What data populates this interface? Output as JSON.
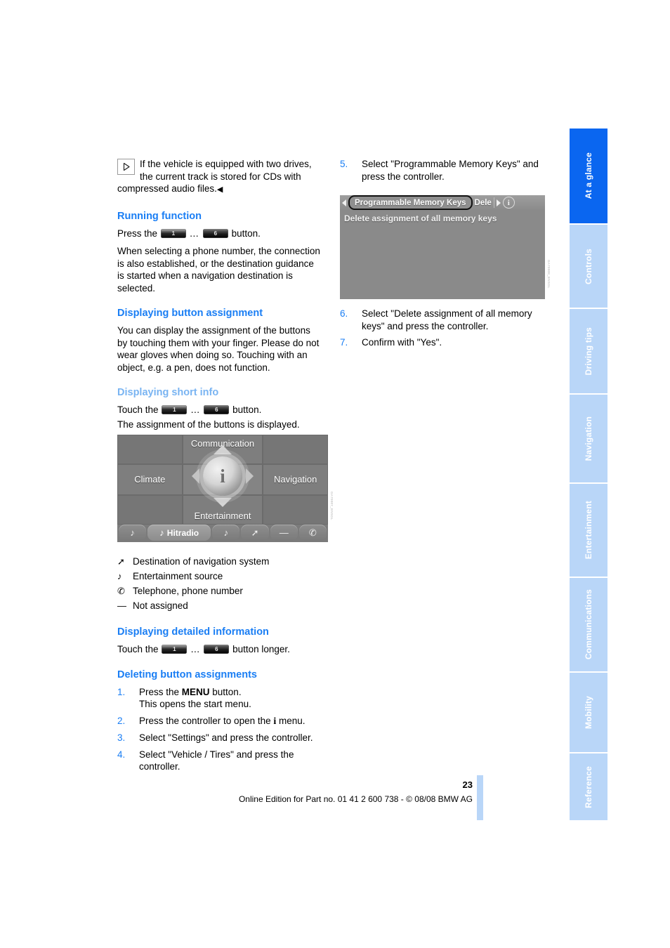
{
  "document": {
    "page_number": "23",
    "footer_line": "Online Edition for Part no. 01 41 2 600 738 - © 08/08 BMW AG"
  },
  "sidebar": {
    "tabs": [
      {
        "label": "At a glance",
        "active": true
      },
      {
        "label": "Controls",
        "active": false
      },
      {
        "label": "Driving tips",
        "active": false
      },
      {
        "label": "Navigation",
        "active": false
      },
      {
        "label": "Entertainment",
        "active": false
      },
      {
        "label": "Communications",
        "active": false
      },
      {
        "label": "Mobility",
        "active": false
      },
      {
        "label": "Reference",
        "active": false
      }
    ],
    "active_color": "#0a66f0",
    "inactive_color": "#b9d6f8"
  },
  "left_column": {
    "note": {
      "icon": "play-triangle-icon",
      "text": "If the vehicle is equipped with two drives, the current track is stored for CDs with compressed audio files.",
      "end_mark": "◀"
    },
    "running_function": {
      "heading": "Running function",
      "instruction_prefix": "Press the",
      "key_from": "1",
      "key_ellipsis": "…",
      "key_to": "6",
      "instruction_suffix": "button.",
      "paragraph": "When selecting a phone number, the connection is also established, or the destination guidance is started when a navigation destination is selected."
    },
    "displaying_button_assignment": {
      "heading": "Displaying button assignment",
      "paragraph": "You can display the assignment of the buttons by touching them with your finger. Please do not wear gloves when doing so. Touching with an object, e.g. a pen, does not function."
    },
    "displaying_short_info": {
      "heading": "Displaying short info",
      "instruction_prefix": "Touch the",
      "key_from": "1",
      "key_ellipsis": "…",
      "key_to": "6",
      "instruction_suffix": "button.",
      "result": "The assignment of the buttons is displayed."
    },
    "legend": [
      {
        "symbol": "navigation-arrow-icon",
        "glyph": "➚",
        "label": "Destination of navigation system"
      },
      {
        "symbol": "music-note-icon",
        "glyph": "♪",
        "label": "Entertainment source"
      },
      {
        "symbol": "telephone-handset-icon",
        "glyph": "✆",
        "label": "Telephone, phone number"
      },
      {
        "symbol": "dash-icon",
        "glyph": "—",
        "label": "Not assigned"
      }
    ],
    "displaying_detailed_information": {
      "heading": "Displaying detailed information",
      "instruction_prefix": "Touch the",
      "key_from": "1",
      "key_ellipsis": "…",
      "key_to": "6",
      "instruction_suffix": "button longer."
    },
    "deleting_button_assignments": {
      "heading": "Deleting button assignments",
      "steps": [
        {
          "num": "1.",
          "pre": "Press the ",
          "bold": "MENU",
          "post": " button.",
          "extra": "This opens the start menu."
        },
        {
          "num": "2.",
          "pre": "Press the controller to open the ",
          "bold": "i",
          "post": " menu.",
          "extra": ""
        },
        {
          "num": "3.",
          "pre": "Select \"Settings\" and press the controller.",
          "bold": "",
          "post": "",
          "extra": ""
        },
        {
          "num": "4.",
          "pre": "Select \"Vehicle / Tires\" and press the controller.",
          "bold": "",
          "post": "",
          "extra": ""
        }
      ]
    }
  },
  "right_column": {
    "steps_top": [
      {
        "num": "5.",
        "text": "Select \"Programmable Memory Keys\" and press the controller."
      }
    ],
    "steps_bottom": [
      {
        "num": "6.",
        "text": "Select \"Delete assignment of all memory keys\" and press the controller."
      },
      {
        "num": "7.",
        "text": "Confirm with \"Yes\"."
      }
    ]
  },
  "screenshot_start_menu": {
    "name": "idrive-start-menu",
    "cells": {
      "top_left": "",
      "top_center": "Communication",
      "top_right": "",
      "mid_left": "Climate",
      "mid_center": "i",
      "mid_right": "Navigation",
      "bottom_left": "",
      "bottom_center": "Entertainment",
      "bottom_right": ""
    },
    "memory_keys": [
      {
        "glyph": "♪",
        "label": "",
        "selected": false,
        "icon": "music-note-icon"
      },
      {
        "glyph": "♪",
        "label": "Hitradio",
        "selected": true,
        "icon": "music-note-icon"
      },
      {
        "glyph": "♪",
        "label": "",
        "selected": false,
        "icon": "music-note-icon"
      },
      {
        "glyph": "➚",
        "label": "",
        "selected": false,
        "icon": "navigation-arrow-icon"
      },
      {
        "glyph": "—",
        "label": "",
        "selected": false,
        "icon": "dash-icon"
      },
      {
        "glyph": "✆",
        "label": "",
        "selected": false,
        "icon": "telephone-handset-icon"
      }
    ],
    "credit": "GA70007_ENSGL"
  },
  "screenshot_memory_keys": {
    "name": "idrive-programmable-memory-keys",
    "breadcrumb_selected": "Programmable Memory Keys",
    "breadcrumb_next": "Dele",
    "info_icon": "i",
    "list_items": [
      "Delete assignment of all memory keys"
    ],
    "credit": "GA70008_ENSGL"
  }
}
